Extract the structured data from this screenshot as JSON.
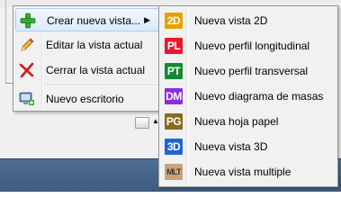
{
  "context_menu": {
    "items": [
      {
        "label": "Crear nueva vista...",
        "icon": "plus-icon",
        "submenu_arrow": "▶"
      },
      {
        "label": "Editar la vista actual",
        "icon": "pencil-icon"
      },
      {
        "label": "Cerrar la vista actual",
        "icon": "close-x-icon"
      },
      {
        "label": "Nuevo escritorio",
        "icon": "new-desktop-icon"
      }
    ]
  },
  "submenu": {
    "items": [
      {
        "badge": "2D",
        "label": "Nueva vista 2D",
        "color": "#e6a100"
      },
      {
        "badge": "PL",
        "label": "Nuevo perfil longitudinal",
        "color": "#e8192c"
      },
      {
        "badge": "PT",
        "label": "Nuevo perfil transversal",
        "color": "#138a32"
      },
      {
        "badge": "DM",
        "label": "Nuevo diagrama de masas",
        "color": "#8a2be2"
      },
      {
        "badge": "PG",
        "label": "Nueva hoja papel",
        "color": "#8a6b1e"
      },
      {
        "badge": "3D",
        "label": "Nueva vista 3D",
        "color": "#1e64d2"
      },
      {
        "badge": "MLT",
        "label": "Nueva vista multiple",
        "color": "#c8a27c"
      }
    ]
  },
  "tray": {
    "caret": "▲"
  }
}
